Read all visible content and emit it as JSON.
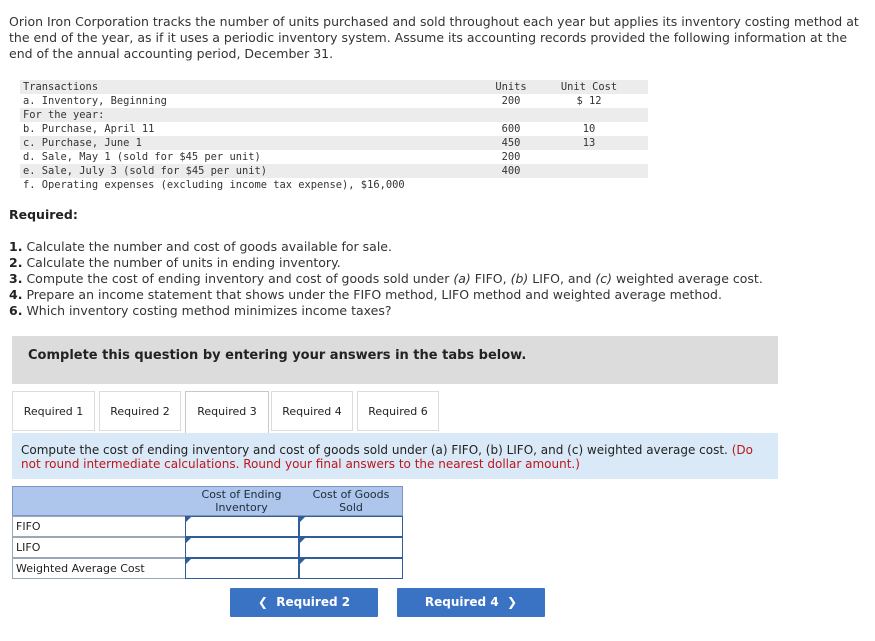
{
  "intro": "Orion Iron Corporation tracks the number of units purchased and sold throughout each year but applies its inventory costing method at the end of the year, as if it uses a periodic inventory system. Assume its accounting records provided the following information at the end of the annual accounting period, December 31.",
  "transactions": {
    "header": {
      "desc": "Transactions",
      "units": "Units",
      "cost": "Unit Cost"
    },
    "rows": [
      {
        "desc": "a. Inventory, Beginning",
        "units": "200",
        "cost": "$ 12"
      },
      {
        "desc": "For the year:",
        "units": "",
        "cost": ""
      },
      {
        "desc": "b. Purchase, April 11",
        "units": "600",
        "cost": "10"
      },
      {
        "desc": "c. Purchase, June 1",
        "units": "450",
        "cost": "13"
      },
      {
        "desc": "d. Sale, May 1 (sold for $45 per unit)",
        "units": "200",
        "cost": ""
      },
      {
        "desc": "e. Sale, July 3 (sold for $45 per unit)",
        "units": "400",
        "cost": ""
      },
      {
        "desc": "f. Operating expenses (excluding income tax expense), $16,000",
        "units": "",
        "cost": ""
      }
    ]
  },
  "required": {
    "heading": "Required:",
    "items": [
      {
        "num": "1.",
        "text": "Calculate the number and cost of goods available for sale."
      },
      {
        "num": "2.",
        "text": "Calculate the number of units in ending inventory."
      },
      {
        "num": "3.",
        "text_a": "Compute the cost of ending inventory and cost of goods sold under ",
        "a": "(a)",
        "t1": " FIFO, ",
        "b": "(b)",
        "t2": " LIFO, and ",
        "c": "(c)",
        "t3": " weighted average cost."
      },
      {
        "num": "4.",
        "text": "Prepare an income statement that shows under the FIFO method, LIFO method and weighted average method."
      },
      {
        "num": "6.",
        "text": "Which inventory costing method minimizes income taxes?"
      }
    ]
  },
  "banner": "Complete this question by entering your answers in the tabs below.",
  "tabs": [
    {
      "label": "Required 1",
      "active": false
    },
    {
      "label": "Required 2",
      "active": false
    },
    {
      "label": "Required 3",
      "active": true
    },
    {
      "label": "Required 4",
      "active": false
    },
    {
      "label": "Required 6",
      "active": false
    }
  ],
  "instruction": {
    "main": "Compute the cost of ending inventory and cost of goods sold under (a) FIFO, (b) LIFO, and (c) weighted average cost.",
    "note": "(Do not round intermediate calculations. Round your final answers to the nearest dollar amount.)"
  },
  "answer_table": {
    "col1": "Cost of Ending Inventory",
    "col2": "Cost of Goods Sold",
    "rows": [
      {
        "label": "FIFO",
        "ending": "",
        "cogs": ""
      },
      {
        "label": "LIFO",
        "ending": "",
        "cogs": ""
      },
      {
        "label": "Weighted Average Cost",
        "ending": "",
        "cogs": ""
      }
    ]
  },
  "nav": {
    "prev": "Required 2",
    "next": "Required 4"
  },
  "colors": {
    "accent": "#3b73c4",
    "note_red": "#c0151b",
    "instruction_bg": "#d9e9f7",
    "header_bg": "#aec6ec"
  }
}
